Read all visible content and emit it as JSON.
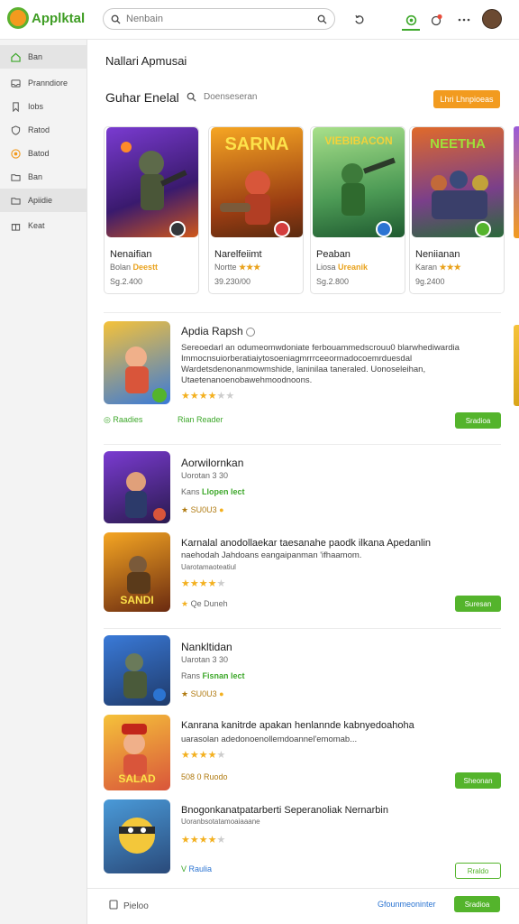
{
  "app": {
    "name": "Applktal"
  },
  "search": {
    "placeholder": "Nenbain"
  },
  "sidebar": {
    "items": [
      {
        "label": "Ban",
        "icon": "home-icon"
      },
      {
        "label": "Pranndiore",
        "icon": "inbox-icon"
      },
      {
        "label": "Iobs",
        "icon": "bookmark-icon"
      },
      {
        "label": "Ratod",
        "icon": "shield-icon"
      },
      {
        "label": "Batod",
        "icon": "target-icon"
      },
      {
        "label": "Ban",
        "icon": "folder-icon"
      },
      {
        "label": "Apiidie",
        "icon": "folder-icon"
      },
      {
        "label": "Keat",
        "icon": "gift-icon"
      }
    ]
  },
  "main": {
    "heading": "Nallari Apmusai",
    "section_title": "Guhar Enelal",
    "section_search": "Doenseseran",
    "section_button": "Lhri Lhnpioeas",
    "cards": [
      {
        "art_text": "",
        "name": "Nenaifian",
        "meta_prefix": "Bolan",
        "meta_hl": "Deestt",
        "price": "Sg.2.400"
      },
      {
        "art_text": "SARNA",
        "name": "Narelfeiimt",
        "meta_prefix": "Nortte",
        "meta_hl": "★★★",
        "price": "39.230/00"
      },
      {
        "art_text": "VIEBIBACON",
        "name": "Peaban",
        "meta_prefix": "Liosa",
        "meta_hl": "Ureanik",
        "price": "Sg.2.800"
      },
      {
        "art_text": "NEETHA",
        "name": "Neniianan",
        "meta_prefix": "Karan",
        "meta_hl": "★★★",
        "price": "9g.2400"
      }
    ],
    "list": [
      {
        "title": "Apdia Rapsh",
        "body": "Sereoedarl an odumeomwdoniate ferbouammedscrouu0 blarwhediwardia Immocnsuiorberatiaiytosoeniagmrrrceeormadocoemrduesdal Wardetsdenonanmowmshide, laninilaa taneraled. Uonoseleihan, Utaetenanoenobawehmoodnoons.",
        "stars": 4,
        "tag1": "Raadies",
        "tag2": "Rian Reader",
        "btn": "Sradioa"
      },
      {
        "title": "Aorwilornkan",
        "sub": "Uorotan 3 30",
        "meta1": "Kans",
        "meta1_hl": "Llopen lect",
        "rating": "SU0U3",
        "art_text": ""
      },
      {
        "title": "Karnalal anodollaekar taesanahe paodk ilkana Apedanlin",
        "body": "naehodah Jahdoans eangaipanman 'ifhaamom.",
        "sub": "Uarotamaoteatiul",
        "stars": 4,
        "meta": "Qe Duneh",
        "btn": "Suresan",
        "art_text": "SANDI"
      },
      {
        "title": "Nankltidan",
        "sub": "Uarotan 3 30",
        "meta1": "Rans",
        "meta1_hl": "Fisnan lect",
        "rating": "SU0U3",
        "art_text": ""
      },
      {
        "title": "Kanrana kanitrde apakan henlannde kabnyedoahoha",
        "body": "uarasolan adedonoenollemdoannel'emomab...",
        "stars": 4,
        "meta": "508 0 Ruodo",
        "btn": "Sheonan",
        "art_text": "SALAD"
      },
      {
        "title": "Bnogonkanatpatarberti Seperanoliak Nernarbin",
        "sub": "Uoranbsotatamoaiaaane",
        "stars": 4,
        "tag": "Raulia",
        "btn": "Rraldo",
        "art_text": ""
      }
    ]
  },
  "footer": {
    "left": "Pieloo",
    "link": "Gfounmeoninter",
    "btn": "Sradioa"
  }
}
